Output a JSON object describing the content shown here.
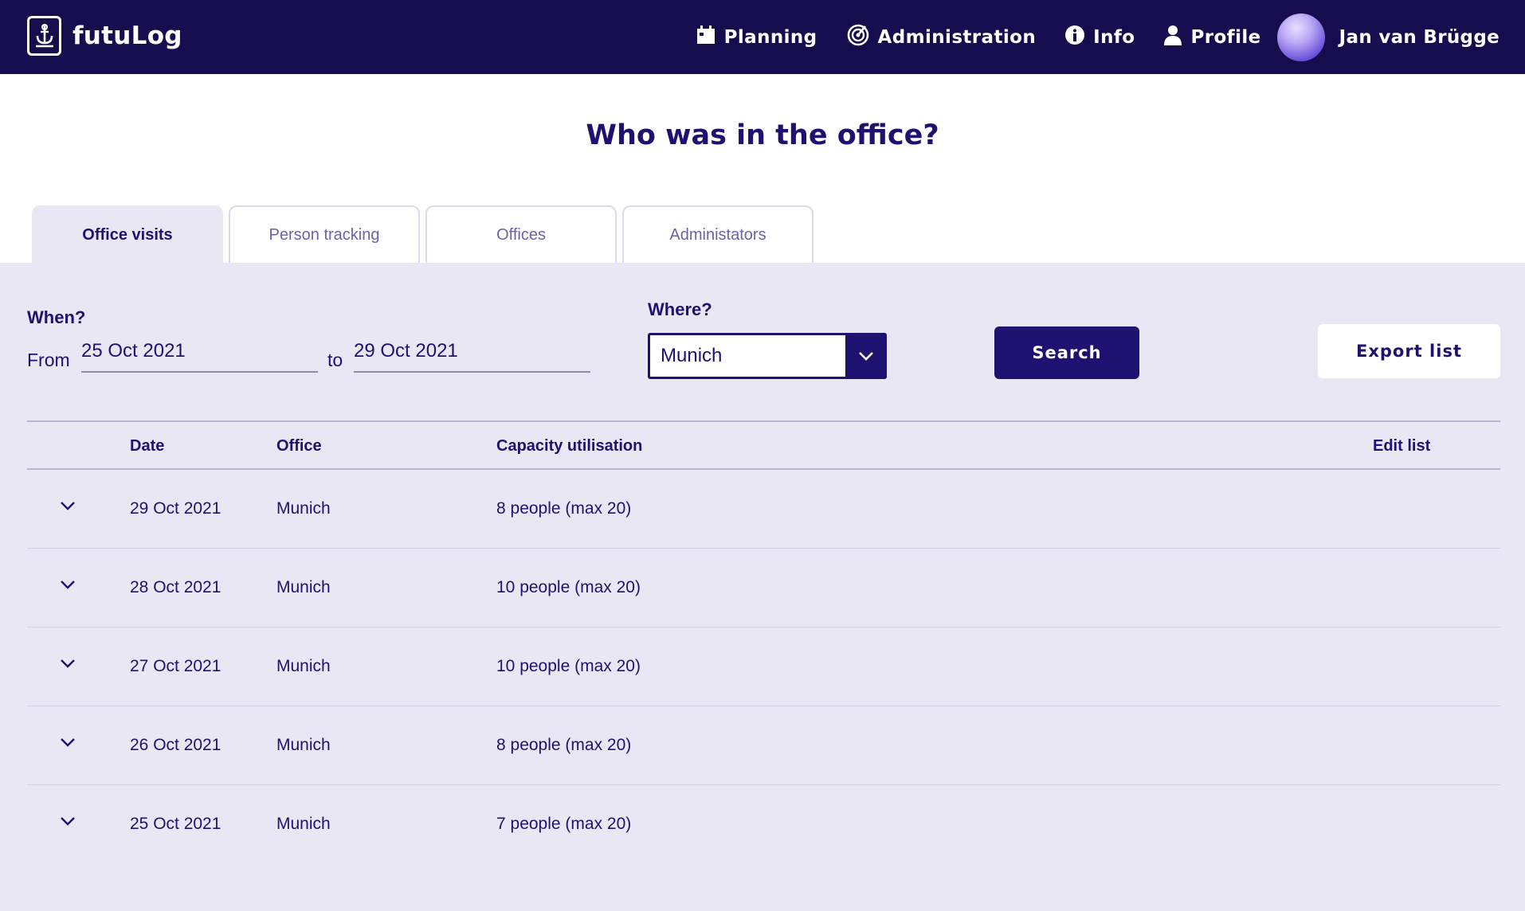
{
  "header": {
    "logo_text": "futuLog",
    "nav": [
      {
        "label": "Planning",
        "icon": "calendar-icon"
      },
      {
        "label": "Administration",
        "icon": "radar-icon"
      },
      {
        "label": "Info",
        "icon": "info-icon"
      },
      {
        "label": "Profile",
        "icon": "person-icon"
      }
    ],
    "user_name": "Jan van Brügge"
  },
  "page": {
    "title": "Who was in the office?"
  },
  "tabs": [
    {
      "label": "Office visits",
      "active": true
    },
    {
      "label": "Person tracking",
      "active": false
    },
    {
      "label": "Offices",
      "active": false
    },
    {
      "label": "Administators",
      "active": false
    }
  ],
  "filters": {
    "when_label": "When?",
    "from_label": "From",
    "from_value": "25 Oct 2021",
    "to_label": "to",
    "to_value": "29 Oct 2021",
    "where_label": "Where?",
    "where_value": "Munich",
    "search_label": "Search",
    "export_label": "Export list"
  },
  "table": {
    "headers": {
      "date": "Date",
      "office": "Office",
      "capacity": "Capacity utilisation",
      "edit": "Edit list"
    },
    "rows": [
      {
        "date": "29 Oct 2021",
        "office": "Munich",
        "capacity": "8 people (max 20)"
      },
      {
        "date": "28 Oct 2021",
        "office": "Munich",
        "capacity": "10 people (max 20)"
      },
      {
        "date": "27 Oct 2021",
        "office": "Munich",
        "capacity": "10 people (max 20)"
      },
      {
        "date": "26 Oct 2021",
        "office": "Munich",
        "capacity": "8 people (max 20)"
      },
      {
        "date": "25 Oct 2021",
        "office": "Munich",
        "capacity": "7 people (max 20)"
      }
    ]
  },
  "colors": {
    "header_bg": "#150d4d",
    "primary": "#1e1270",
    "panel_bg": "#e9e7f3"
  }
}
